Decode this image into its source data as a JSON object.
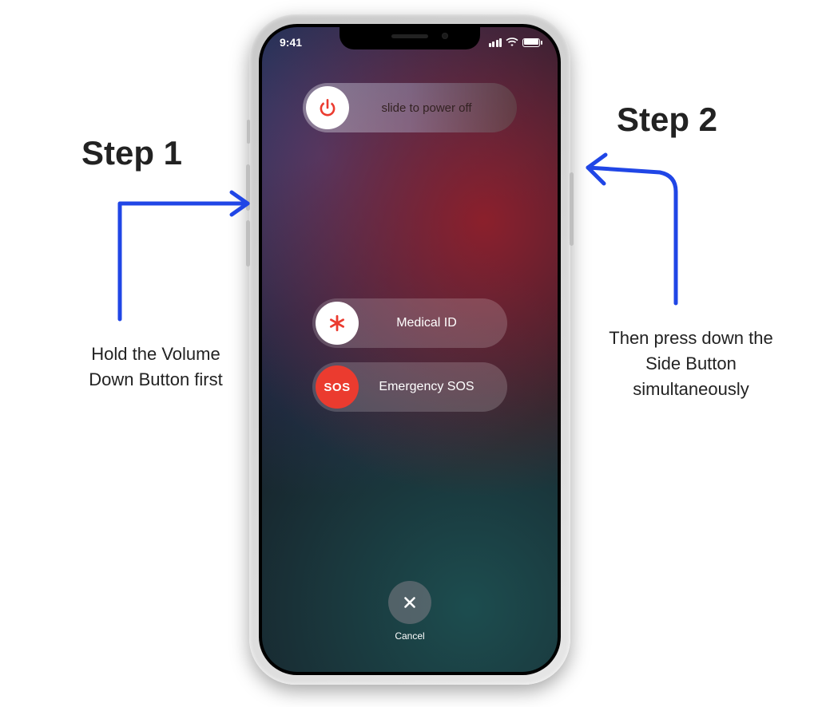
{
  "phone": {
    "status": {
      "time": "9:41"
    },
    "sliders": {
      "power": {
        "label": "slide to power off"
      },
      "medical": {
        "label": "Medical ID",
        "icon": "✱"
      },
      "sos": {
        "label": "Emergency SOS",
        "knob_text": "SOS"
      }
    },
    "cancel": {
      "label": "Cancel"
    }
  },
  "annotations": {
    "step1": {
      "title": "Step 1",
      "desc": "Hold the Volume Down Button first"
    },
    "step2": {
      "title": "Step 2",
      "desc": "Then press down the Side Button simultaneously"
    }
  }
}
